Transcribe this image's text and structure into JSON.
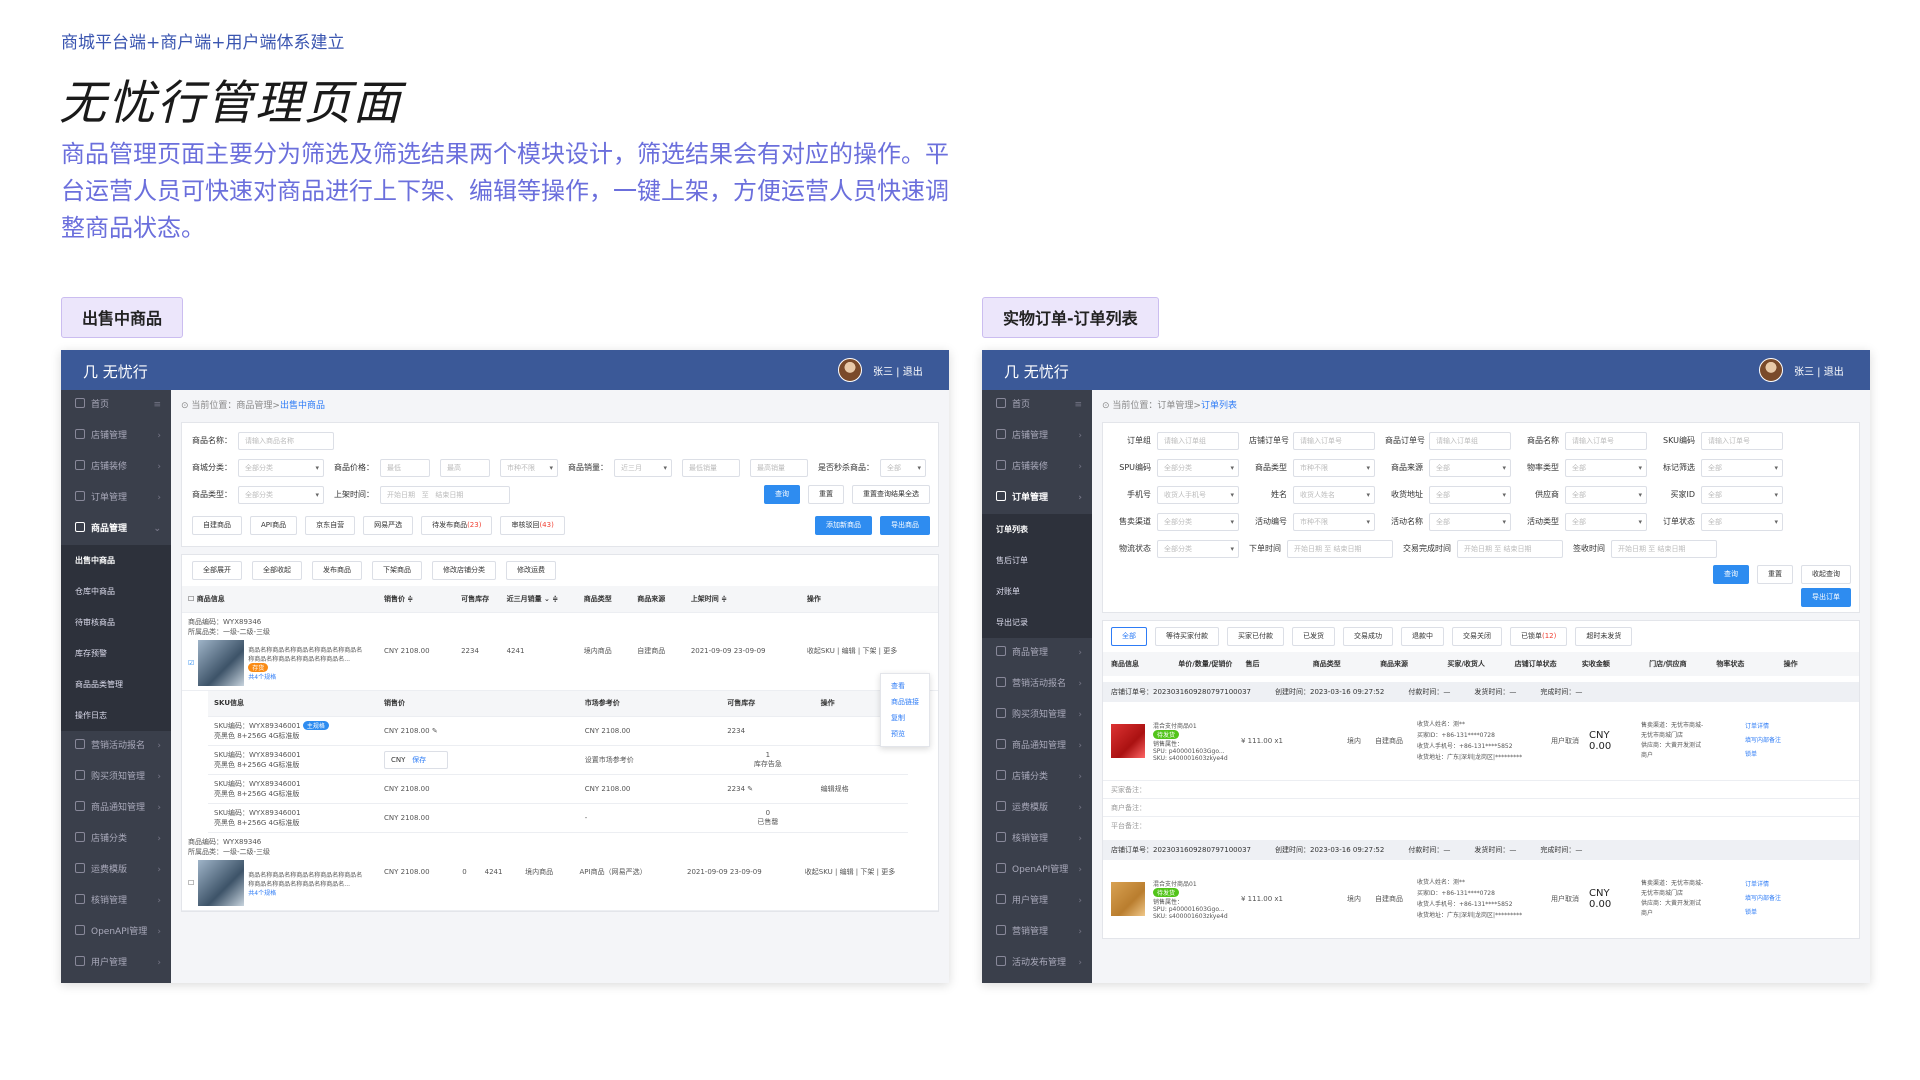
{
  "header": {
    "subtitle": "商城平台端+商户端+用户端体系建立",
    "title": "无忧行管理页面",
    "description": "商品管理页面主要分为筛选及筛选结果两个模块设计，筛选结果会有对应的操作。平台运营人员可快速对商品进行上下架、编辑等操作，一键上架，方便运营人员快速调整商品状态。"
  },
  "left": {
    "label": "出售中商品",
    "app": {
      "logo": "无忧行",
      "user": "张三 | 退出"
    },
    "sidebar": [
      {
        "label": "首页"
      },
      {
        "label": "店铺管理"
      },
      {
        "label": "店铺装修"
      },
      {
        "label": "订单管理"
      },
      {
        "label": "商品管理"
      }
    ],
    "sub": [
      {
        "label": "出售中商品"
      },
      {
        "label": "仓库中商品"
      },
      {
        "label": "待审核商品"
      },
      {
        "label": "库存预警"
      },
      {
        "label": "商品品类管理"
      },
      {
        "label": "操作日志"
      }
    ],
    "sidebar2": [
      {
        "label": "营销活动报名"
      },
      {
        "label": "购买须知管理"
      },
      {
        "label": "商品通知管理"
      },
      {
        "label": "店铺分类"
      },
      {
        "label": "运费模版"
      },
      {
        "label": "核销管理"
      },
      {
        "label": "OpenAPI管理"
      },
      {
        "label": "用户管理"
      }
    ],
    "crumb_prefix": "当前位置：商品管理>",
    "crumb_current": "出售中商品",
    "filters": {
      "name_label": "商品名称：",
      "name_ph": "请输入商品名称",
      "cat_label": "商城分类：",
      "all": "全部分类",
      "price_label": "商品价格：",
      "min": "最低",
      "max": "最高",
      "currency": "市种不限",
      "sales_label": "商品销量：",
      "recent": "近三月",
      "min_sales": "最低销量",
      "max_sales": "最高销量",
      "seckill_label": "是否秒杀商品：",
      "all2": "全部",
      "type_label": "商品类型：",
      "all3": "全部分类",
      "shelf_label": "上架时间：",
      "start": "开始日期",
      "to": "至",
      "end": "结束日期",
      "query": "查询",
      "reset": "重置",
      "reset_all": "重置查询结果全选"
    },
    "sources": [
      "自建商品",
      "API商品",
      "京东自营",
      "网易严选"
    ],
    "pending": "待发布商品",
    "pending_n": "(23)",
    "reject": "审核驳回",
    "reject_n": "(43)",
    "add": "添加新商品",
    "export": "导出商品",
    "batch": [
      "全部展开",
      "全部收起",
      "发布商品",
      "下架商品",
      "修改店铺分类",
      "修改运费"
    ],
    "cols": [
      "商品信息",
      "销售价 ≑",
      "可售库存",
      "近三月销量 ⌄ ≑",
      "商品类型",
      "商品来源",
      "上架时间 ≑",
      "操作"
    ],
    "p1": {
      "code": "商品编码：WYX89346",
      "cat": "所属品类：一级-二级-三级",
      "name": "商品名称商品名称商品名称商品名称商品名称商品名称商品名称商品名称商品名...",
      "tag": "存货",
      "spec": "共4个规格",
      "price": "CNY 2108.00",
      "stock": "2234",
      "sales": "4241",
      "type": "境内商品",
      "src": "自建商品",
      "time": "2021-09-09 23-09-09",
      "ops": "收起SKU | 编辑 | 下架 | 更多"
    },
    "menu": [
      "查看",
      "商品链接",
      "复制",
      "预览"
    ],
    "skucols": [
      "SKU信息",
      "销售价",
      "市场参考价",
      "可售库存",
      "操作"
    ],
    "skus": [
      {
        "code": "SKU编码：WYX89346001",
        "spec": "亮黑色 8+256G 4G标准版",
        "price": "CNY 2108.00",
        "ref": "CNY 2108.00",
        "stock": "2234"
      },
      {
        "code": "SKU编码：WYX89346001",
        "spec": "亮黑色 8+256G 4G标准版",
        "cur": "CNY",
        "save": "保存",
        "ref": "设置市场参考价",
        "stock": "1",
        "warn": "库存告急"
      },
      {
        "code": "SKU编码：WYX89346001",
        "spec": "亮黑色 8+256G 4G标准版",
        "price": "CNY 2108.00",
        "ref": "CNY 2108.00",
        "stock": "2234"
      },
      {
        "code": "SKU编码：WYX89346001",
        "spec": "亮黑色 8+256G 4G标准版",
        "price": "CNY 2108.00",
        "ref": "-",
        "stock": "0",
        "warn": "已售罄"
      }
    ],
    "main_tag": "主规格",
    "edit_spec": "编辑规格",
    "p2": {
      "code": "商品编码：WYX89346",
      "cat": "所属品类：一级-二级-三级",
      "name": "商品名称商品名称商品名称商品名称商品名称商品名称商品名称商品名称商品名...",
      "spec": "共4个规格",
      "price": "CNY 2108.00",
      "stock": "0",
      "sales": "4241",
      "type": "境内商品",
      "src": "API商品（网易严选）",
      "time": "2021-09-09 23-09-09",
      "ops": "收起SKU | 编辑 | 下架 | 更多"
    }
  },
  "right": {
    "label": "实物订单-订单列表",
    "app": {
      "logo": "无忧行",
      "user": "张三 | 退出"
    },
    "sidebar": [
      {
        "label": "首页"
      },
      {
        "label": "店铺管理"
      },
      {
        "label": "店铺装修"
      },
      {
        "label": "订单管理"
      }
    ],
    "sub": [
      {
        "label": "订单列表"
      },
      {
        "label": "售后订单"
      },
      {
        "label": "对账单"
      },
      {
        "label": "导出记录"
      }
    ],
    "sidebar2": [
      {
        "label": "商品管理"
      },
      {
        "label": "营销活动报名"
      },
      {
        "label": "购买须知管理"
      },
      {
        "label": "商品通知管理"
      },
      {
        "label": "店铺分类"
      },
      {
        "label": "运费模版"
      },
      {
        "label": "核销管理"
      },
      {
        "label": "OpenAPI管理"
      },
      {
        "label": "用户管理"
      },
      {
        "label": "营销管理"
      },
      {
        "label": "活动发布管理"
      }
    ],
    "crumb_prefix": "当前位置：订单管理>",
    "crumb_current": "订单列表",
    "frows": [
      [
        [
          "订单组",
          "请输入订单组"
        ],
        [
          "店铺订单号",
          "请输入订单号"
        ],
        [
          "商品订单号",
          "请输入订单组"
        ],
        [
          "商品名称",
          "请输入订单号"
        ],
        [
          "SKU编码",
          "请输入订单号"
        ]
      ],
      [
        [
          "SPU编码",
          "全部分类"
        ],
        [
          "商品类型",
          "市种不限"
        ],
        [
          "商品来源",
          "全部"
        ],
        [
          "物率类型",
          "全部"
        ],
        [
          "标记筛选",
          "全部"
        ]
      ],
      [
        [
          "手机号",
          "收货人手机号"
        ],
        [
          "姓名",
          "收货人姓名"
        ],
        [
          "收货地址",
          "全部"
        ],
        [
          "供应商",
          "全部"
        ],
        [
          "买家ID",
          "全部"
        ]
      ],
      [
        [
          "售卖渠道",
          "全部分类"
        ],
        [
          "活动编号",
          "市种不限"
        ],
        [
          "活动名称",
          "全部"
        ],
        [
          "活动类型",
          "全部"
        ],
        [
          "订单状态",
          "全部"
        ]
      ]
    ],
    "r5": {
      "ship": "物流状态",
      "all": "全部分类",
      "order_time": "下单时间",
      "start": "开始日期",
      "to": "至",
      "end": "结束日期",
      "done_time": "交易完成时间",
      "recv_time": "签收时间",
      "query": "查询",
      "reset": "重置",
      "fold": "收起查询",
      "export": "导出订单"
    },
    "status": [
      "全部",
      "等待买家付款",
      "买家已付款",
      "已发货",
      "交易成功",
      "退款中",
      "交易关闭",
      "已锁单"
    ],
    "status_n": "(12)",
    "overdue": "超时未发货",
    "cols": [
      "商品信息",
      "单价/数量/促销价",
      "售后",
      "商品类型",
      "商品来源",
      "买家/收货人",
      "店铺订单状态",
      "实收金额",
      "门店/供应商",
      "物率状态",
      "操作"
    ],
    "orders": [
      {
        "no": "店铺订单号：2023031609280797100037",
        "created": "创建时间：2023-03-16 09:27:52",
        "paid": "付款时间：—",
        "sent": "发货时间：—",
        "done": "完成时间：—",
        "name": "混合支付商品01",
        "tag": "待发货",
        "attr": "销售属性：",
        "spu": "SPU: p400001603Ggo...",
        "sku": "SKU: s400001603zkye4d",
        "price": "¥ 111.00 x1",
        "loc": "境内",
        "src": "自建商品",
        "buyer": "收货人姓名：测**",
        "bid": "买家ID：+86-131****0728",
        "bphone": "收货人手机号：+86-131****5852",
        "baddr": "收货地址：广东|深圳|龙岗区|*********",
        "state": "用户取消",
        "amount": "CNY 0.00",
        "store": "售卖渠道：无忧市商城-无忧市商城门店",
        "sup": "供应商：大黄开发测试商户",
        "ops": [
          "订单详情",
          "填写内部备注",
          "锁单"
        ]
      },
      {
        "no": "店铺订单号：2023031609280797100037",
        "created": "创建时间：2023-03-16 09:27:52",
        "paid": "付款时间：—",
        "sent": "发货时间：—",
        "done": "完成时间：—",
        "name": "混合支付商品01",
        "tag": "待发货",
        "attr": "销售属性：",
        "spu": "SPU: p400001603Ggo...",
        "sku": "SKU: s400001603zkye4d",
        "price": "¥ 111.00 x1",
        "loc": "境内",
        "src": "自建商品",
        "buyer": "收货人姓名：测**",
        "bid": "买家ID：+86-131****0728",
        "bphone": "收货人手机号：+86-131****5852",
        "baddr": "收货地址：广东|深圳|龙岗区|*********",
        "state": "用户取消",
        "amount": "CNY 0.00",
        "store": "售卖渠道：无忧市商城-无忧市商城门店",
        "sup": "供应商：大黄开发测试商户",
        "ops": [
          "订单详情",
          "填写内部备注",
          "锁单"
        ]
      }
    ],
    "notes": [
      "买家备注：",
      "商户备注：",
      "平台备注："
    ]
  }
}
